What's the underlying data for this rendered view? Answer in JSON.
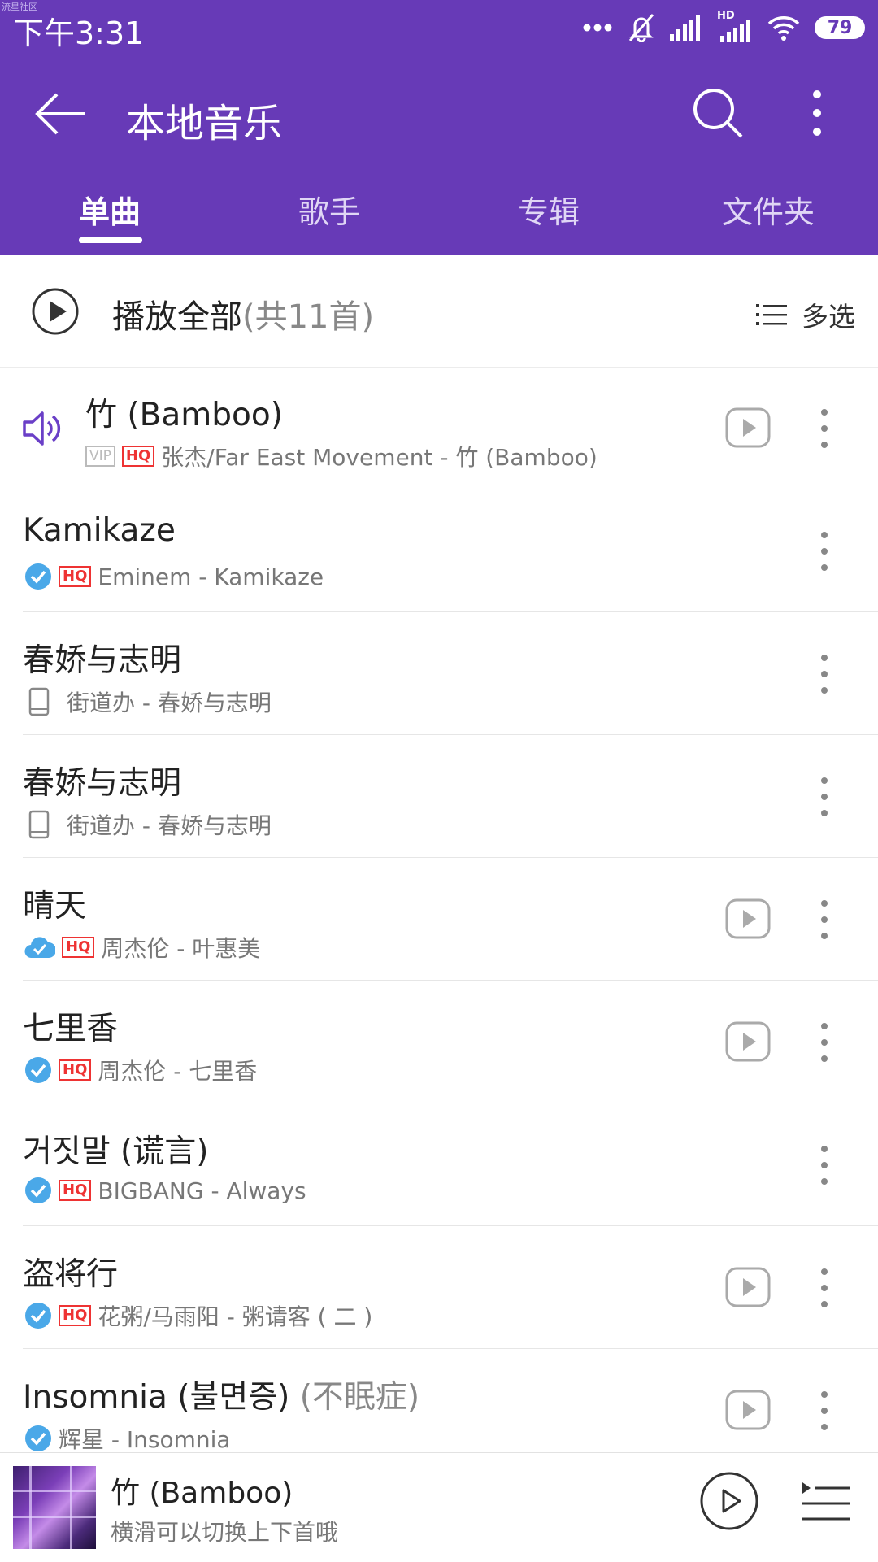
{
  "status_bar": {
    "watermark": "流星社区",
    "time": "下午3:31",
    "network_label": "HD",
    "battery": "79"
  },
  "app_bar": {
    "title": "本地音乐"
  },
  "tabs": [
    {
      "label": "单曲",
      "active": true
    },
    {
      "label": "歌手",
      "active": false
    },
    {
      "label": "专辑",
      "active": false
    },
    {
      "label": "文件夹",
      "active": false
    }
  ],
  "play_all": {
    "label": "播放全部",
    "count": "(共11首)",
    "multiselect": "多选"
  },
  "colors": {
    "accent": "#673ab7",
    "hq_red": "#e33333",
    "check_blue": "#4aa8e8",
    "playing": "#6a3fc7"
  },
  "songs": [
    {
      "title": "竹 (Bamboo)",
      "title_dim": "",
      "status": "playing",
      "vip": "VIP",
      "hq": "HQ",
      "source_icon": "",
      "meta": "张杰/Far East Movement - 竹 (Bamboo)",
      "has_play": true
    },
    {
      "title": "Kamikaze",
      "title_dim": "",
      "status": "",
      "vip": "",
      "hq": "HQ",
      "source_icon": "check-circle-icon",
      "meta": "Eminem - Kamikaze",
      "has_play": false
    },
    {
      "title": "春娇与志明",
      "title_dim": "",
      "status": "",
      "vip": "",
      "hq": "",
      "source_icon": "phone-icon",
      "meta": "街道办 - 春娇与志明",
      "has_play": false
    },
    {
      "title": "春娇与志明",
      "title_dim": "",
      "status": "",
      "vip": "",
      "hq": "",
      "source_icon": "phone-icon",
      "meta": "街道办 - 春娇与志明",
      "has_play": false
    },
    {
      "title": "晴天",
      "title_dim": "",
      "status": "",
      "vip": "",
      "hq": "HQ",
      "source_icon": "cloud-check-icon",
      "meta": "周杰伦 - 叶惠美",
      "has_play": true
    },
    {
      "title": "七里香",
      "title_dim": "",
      "status": "",
      "vip": "",
      "hq": "HQ",
      "source_icon": "check-circle-icon",
      "meta": "周杰伦 - 七里香",
      "has_play": true
    },
    {
      "title": "거짓말 (谎言)",
      "title_dim": "",
      "status": "",
      "vip": "",
      "hq": "HQ",
      "source_icon": "check-circle-icon",
      "meta": "BIGBANG - Always",
      "has_play": false
    },
    {
      "title": "盗将行",
      "title_dim": "",
      "status": "",
      "vip": "",
      "hq": "HQ",
      "source_icon": "check-circle-icon",
      "meta": "花粥/马雨阳 - 粥请客 ( 二 )",
      "has_play": true
    },
    {
      "title": "Insomnia (불면증)",
      "title_dim": "(不眠症)",
      "status": "",
      "vip": "",
      "hq": "",
      "source_icon": "check-circle-icon",
      "meta": "辉星 - Insomnia",
      "has_play": true
    }
  ],
  "mini_player": {
    "title": "竹 (Bamboo)",
    "subtitle": "横滑可以切换上下首哦"
  }
}
